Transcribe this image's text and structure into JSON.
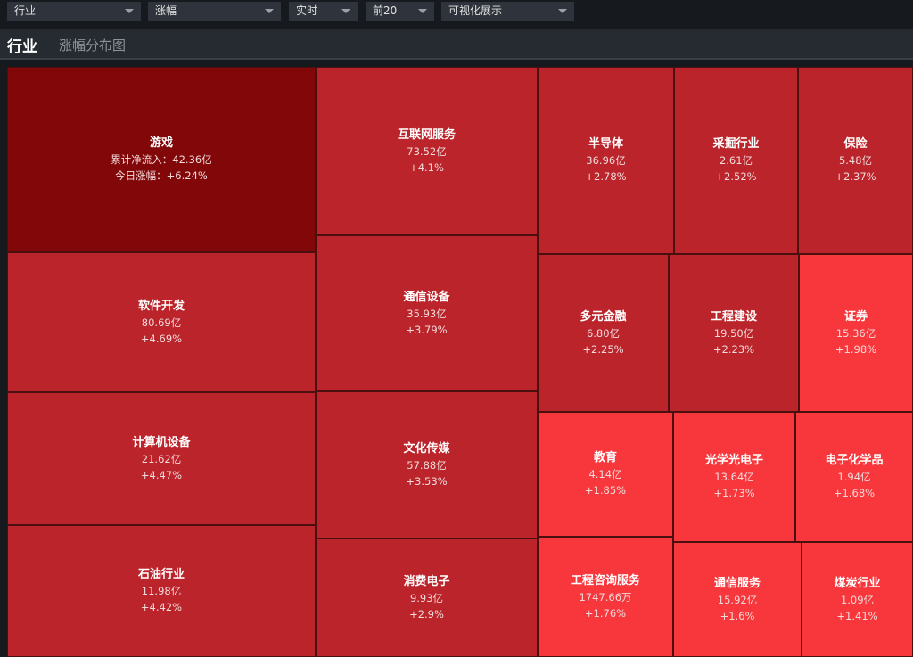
{
  "filters": [
    {
      "value": "行业"
    },
    {
      "value": "涨幅"
    },
    {
      "value": "实时"
    },
    {
      "value": "前20"
    },
    {
      "value": "可视化展示"
    }
  ],
  "header": {
    "title": "行业",
    "subtitle": "涨幅分布图"
  },
  "colors": {
    "deep": "#820709",
    "mid": "#bb242b",
    "bright": "#f8373c"
  },
  "tiles": [
    {
      "name": "游戏",
      "flow": "累计净流入：42.36亿",
      "change": "今日涨幅：+6.24%",
      "tone": "deep"
    },
    {
      "name": "互联网服务",
      "flow": "73.52亿",
      "change": "+4.1%",
      "tone": "mid"
    },
    {
      "name": "半导体",
      "flow": "36.96亿",
      "change": "+2.78%",
      "tone": "mid"
    },
    {
      "name": "采掘行业",
      "flow": "2.61亿",
      "change": "+2.52%",
      "tone": "mid"
    },
    {
      "name": "保险",
      "flow": "5.48亿",
      "change": "+2.37%",
      "tone": "mid"
    },
    {
      "name": "软件开发",
      "flow": "80.69亿",
      "change": "+4.69%",
      "tone": "mid"
    },
    {
      "name": "通信设备",
      "flow": "35.93亿",
      "change": "+3.79%",
      "tone": "mid"
    },
    {
      "name": "多元金融",
      "flow": "6.80亿",
      "change": "+2.25%",
      "tone": "mid"
    },
    {
      "name": "工程建设",
      "flow": "19.50亿",
      "change": "+2.23%",
      "tone": "mid"
    },
    {
      "name": "证券",
      "flow": "15.36亿",
      "change": "+1.98%",
      "tone": "bright"
    },
    {
      "name": "计算机设备",
      "flow": "21.62亿",
      "change": "+4.47%",
      "tone": "mid"
    },
    {
      "name": "文化传媒",
      "flow": "57.88亿",
      "change": "+3.53%",
      "tone": "mid"
    },
    {
      "name": "教育",
      "flow": "4.14亿",
      "change": "+1.85%",
      "tone": "bright"
    },
    {
      "name": "光学光电子",
      "flow": "13.64亿",
      "change": "+1.73%",
      "tone": "bright"
    },
    {
      "name": "电子化学品",
      "flow": "1.94亿",
      "change": "+1.68%",
      "tone": "bright"
    },
    {
      "name": "石油行业",
      "flow": "11.98亿",
      "change": "+4.42%",
      "tone": "mid"
    },
    {
      "name": "消费电子",
      "flow": "9.93亿",
      "change": "+2.9%",
      "tone": "mid"
    },
    {
      "name": "工程咨询服务",
      "flow": "1747.66万",
      "change": "+1.76%",
      "tone": "bright"
    },
    {
      "name": "通信服务",
      "flow": "15.92亿",
      "change": "+1.6%",
      "tone": "bright"
    },
    {
      "name": "煤炭行业",
      "flow": "1.09亿",
      "change": "+1.41%",
      "tone": "bright"
    }
  ]
}
